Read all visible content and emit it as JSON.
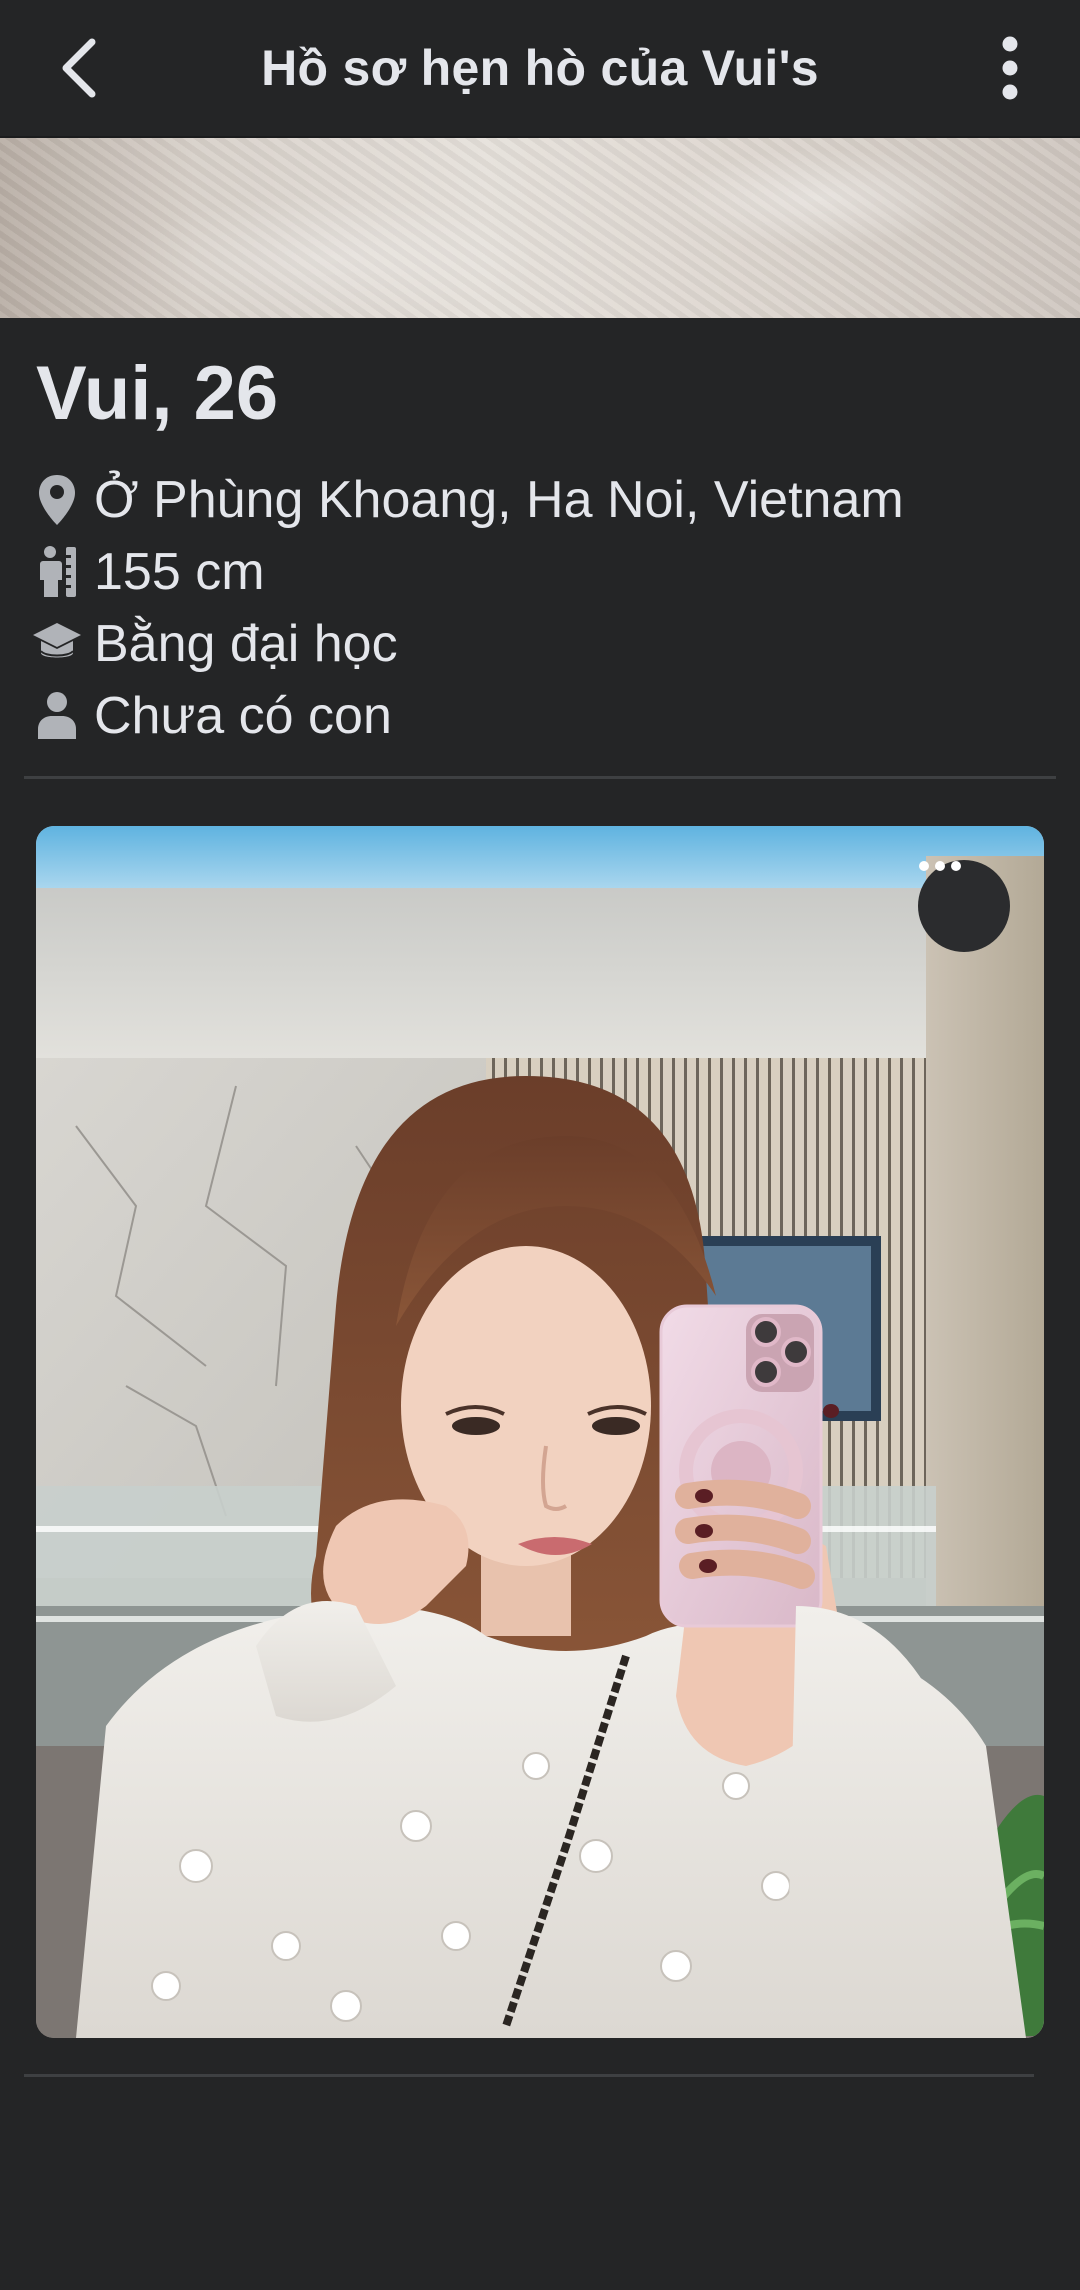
{
  "header": {
    "title": "Hồ sơ hẹn hò của Vui's",
    "back_icon": "chevron-left-icon",
    "more_icon": "vertical-ellipsis-icon"
  },
  "profile": {
    "name_age": "Vui, 26",
    "details": [
      {
        "icon": "location-pin-icon",
        "text": "Ở Phùng Khoang, Ha Noi, Vietnam"
      },
      {
        "icon": "height-icon",
        "text": "155 cm"
      },
      {
        "icon": "graduation-cap-icon",
        "text": "Bằng đại học"
      },
      {
        "icon": "person-icon",
        "text": "Chưa có con"
      }
    ]
  },
  "photo": {
    "more_icon": "horizontal-ellipsis-icon"
  },
  "colors": {
    "background": "#242526",
    "text": "#e4e6eb",
    "icon": "#b0b3b8",
    "divider": "#3e4042"
  }
}
